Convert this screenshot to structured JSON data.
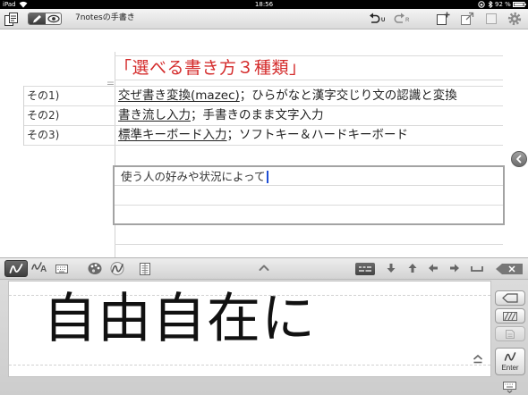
{
  "status_bar": {
    "device": "iPad",
    "time": "18:56",
    "battery": "92 %"
  },
  "toolbar": {
    "title": "7notesの手書き",
    "undo_badge": "U",
    "redo_badge": "R",
    "left_icons": [
      "notebook-icon",
      "pen-icon",
      "eye-icon"
    ],
    "right_icons": [
      "add-page-icon",
      "export-icon",
      "duplicate-icon",
      "gear-icon"
    ]
  },
  "note": {
    "heading": "「選べる書き方３種類」",
    "rows": [
      {
        "label": "その1)",
        "term": "交ぜ書き変換(mazec)",
        "description": "；ひらがなと漢字交じり文の認識と変換"
      },
      {
        "label": "その2)",
        "term": "書き流し入力",
        "description": "；手書きのまま文字入力"
      },
      {
        "label": "その3)",
        "term": "標準キーボード入力",
        "description": "；ソフトキー＆ハードキーボード"
      }
    ],
    "input_box": {
      "text": "使う人の好みや状況によって"
    }
  },
  "input_panel": {
    "toolbar": {
      "pen_to_text_letter": "A",
      "icons": [
        "handwriting-stroke-icon",
        "stroke-icon",
        "keyboard-icon",
        "palette-icon",
        "brush-icon",
        "page-layout-icon",
        "chevron-up-icon",
        "mazec-keyboard-icon",
        "arrow-down-icon",
        "arrow-up-icon",
        "arrow-left-icon",
        "arrow-right-icon",
        "space-icon",
        "backspace-icon"
      ]
    },
    "handwriting": "自由自在に",
    "enter_label": "Enter"
  },
  "colors": {
    "heading": "#d42b2b",
    "cursor": "#1e4fd6",
    "ink": "#111111"
  }
}
